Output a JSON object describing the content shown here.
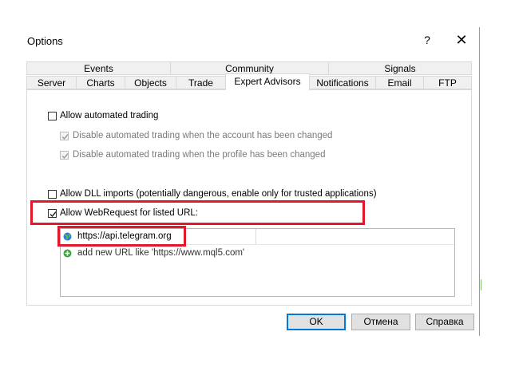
{
  "window": {
    "title": "Options",
    "help_icon": "?",
    "close_icon": "✕"
  },
  "tabs": {
    "row1": [
      "Events",
      "Community",
      "Signals"
    ],
    "row2": [
      "Server",
      "Charts",
      "Objects",
      "Trade",
      "Expert Advisors",
      "Notifications",
      "Email",
      "FTP"
    ],
    "active": "Expert Advisors"
  },
  "options": {
    "allow_automated_trading": {
      "label": "Allow automated trading",
      "checked": false
    },
    "disable_on_account_change": {
      "label": "Disable automated trading when the account has been changed",
      "checked": true,
      "disabled": true
    },
    "disable_on_profile_change": {
      "label": "Disable automated trading when the profile has been changed",
      "checked": true,
      "disabled": true
    },
    "allow_dll_imports": {
      "label": "Allow DLL imports (potentially dangerous, enable only for trusted applications)",
      "checked": false
    },
    "allow_webrequest": {
      "label": "Allow WebRequest for listed URL:",
      "checked": true
    }
  },
  "url_list": {
    "entries": [
      "https://api.telegram.org"
    ],
    "add_new_label": "add new URL like 'https://www.mql5.com'"
  },
  "buttons": {
    "ok": "OK",
    "cancel": "Отмена",
    "help": "Справка"
  },
  "colors": {
    "highlight": "#e3172a",
    "ok_border": "#0078d7",
    "add_icon": "#3aa53a",
    "globe_icon": "#2f7fcf"
  }
}
